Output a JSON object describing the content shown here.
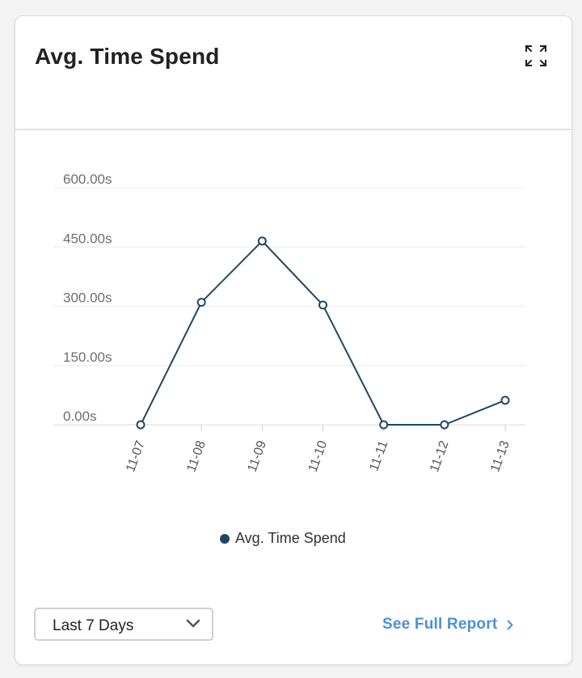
{
  "card": {
    "title": "Avg. Time Spend",
    "expand_icon": "expand-icon"
  },
  "chart_data": {
    "type": "line",
    "title": "",
    "xlabel": "",
    "ylabel": "",
    "categories": [
      "11-07",
      "11-08",
      "11-09",
      "11-10",
      "11-11",
      "11-12",
      "11-13"
    ],
    "series": [
      {
        "name": "Avg. Time Spend",
        "values": [
          0,
          310,
          465,
          303,
          0,
          0,
          62
        ],
        "color": "#1e4763"
      }
    ],
    "ylim": [
      0,
      600
    ],
    "yticks": [
      0,
      150,
      300,
      450,
      600
    ],
    "ytick_labels": [
      "0.00s",
      "150.00s",
      "300.00s",
      "450.00s",
      "600.00s"
    ],
    "grid": true,
    "legend": "bottom-center"
  },
  "legend": {
    "label": "Avg. Time Spend",
    "color": "#1e4763"
  },
  "footer": {
    "range_value": "Last 7 Days",
    "range_icon": "chevron-down-icon",
    "report_label": "See Full Report",
    "report_icon": "chevron-right-icon",
    "link_color": "#4a90d9"
  }
}
